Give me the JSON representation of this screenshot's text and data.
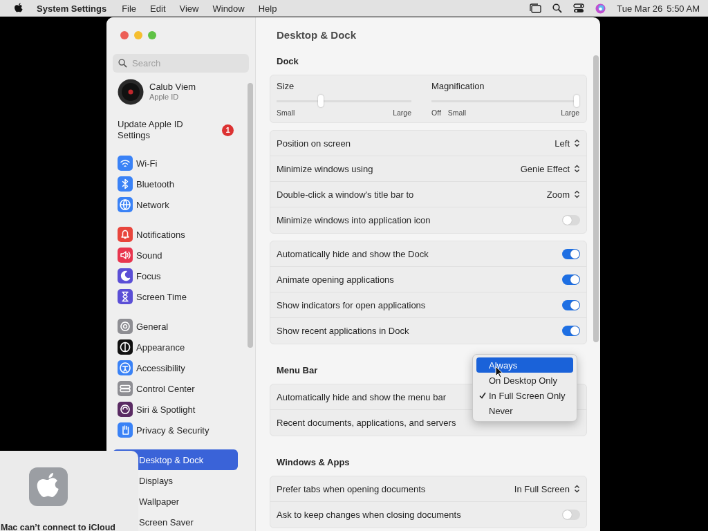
{
  "menu_bar": {
    "app_name": "System Settings",
    "menus": [
      "File",
      "Edit",
      "View",
      "Window",
      "Help"
    ],
    "date": "Tue Mar 26",
    "time": "5:50 AM"
  },
  "window": {
    "title": "Desktop & Dock"
  },
  "sidebar": {
    "search": {
      "placeholder": "Search"
    },
    "account": {
      "name": "Calub Viem",
      "subtitle": "Apple ID"
    },
    "notice": {
      "label": "Update Apple ID Settings",
      "badge": "1"
    },
    "groups": [
      [
        {
          "label": "Wi-Fi",
          "color": "#3a82f6",
          "selected": false
        },
        {
          "label": "Bluetooth",
          "color": "#3a82f6",
          "selected": false
        },
        {
          "label": "Network",
          "color": "#3a82f6",
          "selected": false
        }
      ],
      [
        {
          "label": "Notifications",
          "color": "#e8453c",
          "selected": false
        },
        {
          "label": "Sound",
          "color": "#e8364f",
          "selected": false
        },
        {
          "label": "Focus",
          "color": "#5b4fd6",
          "selected": false
        },
        {
          "label": "Screen Time",
          "color": "#5b4fd6",
          "selected": false
        }
      ],
      [
        {
          "label": "General",
          "color": "#8e8e93",
          "selected": false
        },
        {
          "label": "Appearance",
          "color": "#111111",
          "selected": false
        },
        {
          "label": "Accessibility",
          "color": "#3a82f6",
          "selected": false
        },
        {
          "label": "Control Center",
          "color": "#8e8e93",
          "selected": false
        },
        {
          "label": "Siri & Spotlight",
          "color": "#5a2b63",
          "selected": false
        },
        {
          "label": "Privacy & Security",
          "color": "#3a82f6",
          "selected": false
        }
      ],
      [
        {
          "label": "Desktop & Dock",
          "selected": true
        },
        {
          "label": "Displays",
          "selected": false
        },
        {
          "label": "Wallpaper",
          "selected": false
        },
        {
          "label": "Screen Saver",
          "selected": false
        }
      ]
    ]
  },
  "sections": [
    {
      "heading": "Dock",
      "cards": [
        {
          "kind": "sliders",
          "sliders": [
            {
              "label": "Size",
              "level": 0.32,
              "left_labels": [
                "Small"
              ],
              "right_label": "Large"
            },
            {
              "label": "Magnification",
              "level": 1,
              "left_labels": [
                "Off",
                "Small"
              ],
              "right_label": "Large"
            }
          ]
        },
        {
          "kind": "rows",
          "rows": [
            {
              "kind": "popup",
              "label": "Position on screen",
              "value": "Left"
            },
            {
              "kind": "popup",
              "label": "Minimize windows using",
              "value": "Genie Effect"
            },
            {
              "kind": "popup",
              "label": "Double-click a window's title bar to",
              "value": "Zoom"
            },
            {
              "kind": "toggle",
              "label": "Minimize windows into application icon",
              "on": false
            }
          ]
        },
        {
          "kind": "rows",
          "rows": [
            {
              "kind": "toggle",
              "label": "Automatically hide and show the Dock",
              "on": true
            },
            {
              "kind": "toggle",
              "label": "Animate opening applications",
              "on": true
            },
            {
              "kind": "toggle",
              "label": "Show indicators for open applications",
              "on": true
            },
            {
              "kind": "toggle",
              "label": "Show recent applications in Dock",
              "on": true
            }
          ]
        }
      ]
    },
    {
      "heading": "Menu Bar",
      "cards": [
        {
          "kind": "rows",
          "rows": [
            {
              "kind": "popup",
              "label": "Automatically hide and show the menu bar"
            },
            {
              "kind": "popup",
              "label": "Recent documents, applications, and servers"
            }
          ]
        }
      ]
    },
    {
      "heading": "Windows & Apps",
      "cards": [
        {
          "kind": "rows",
          "rows": [
            {
              "kind": "popup",
              "label": "Prefer tabs when opening documents",
              "value": "In Full Screen"
            },
            {
              "kind": "toggle",
              "label": "Ask to keep changes when closing documents",
              "on": false
            }
          ]
        }
      ]
    }
  ],
  "popup_menu": {
    "items": [
      {
        "label": "Always",
        "selected": true,
        "checked": false
      },
      {
        "label": "On Desktop Only",
        "selected": false,
        "checked": false
      },
      {
        "label": "In Full Screen Only",
        "selected": false,
        "checked": true
      },
      {
        "label": "Never",
        "selected": false,
        "checked": false
      }
    ]
  },
  "notification": {
    "title": "Mac can’t connect to iCloud"
  }
}
